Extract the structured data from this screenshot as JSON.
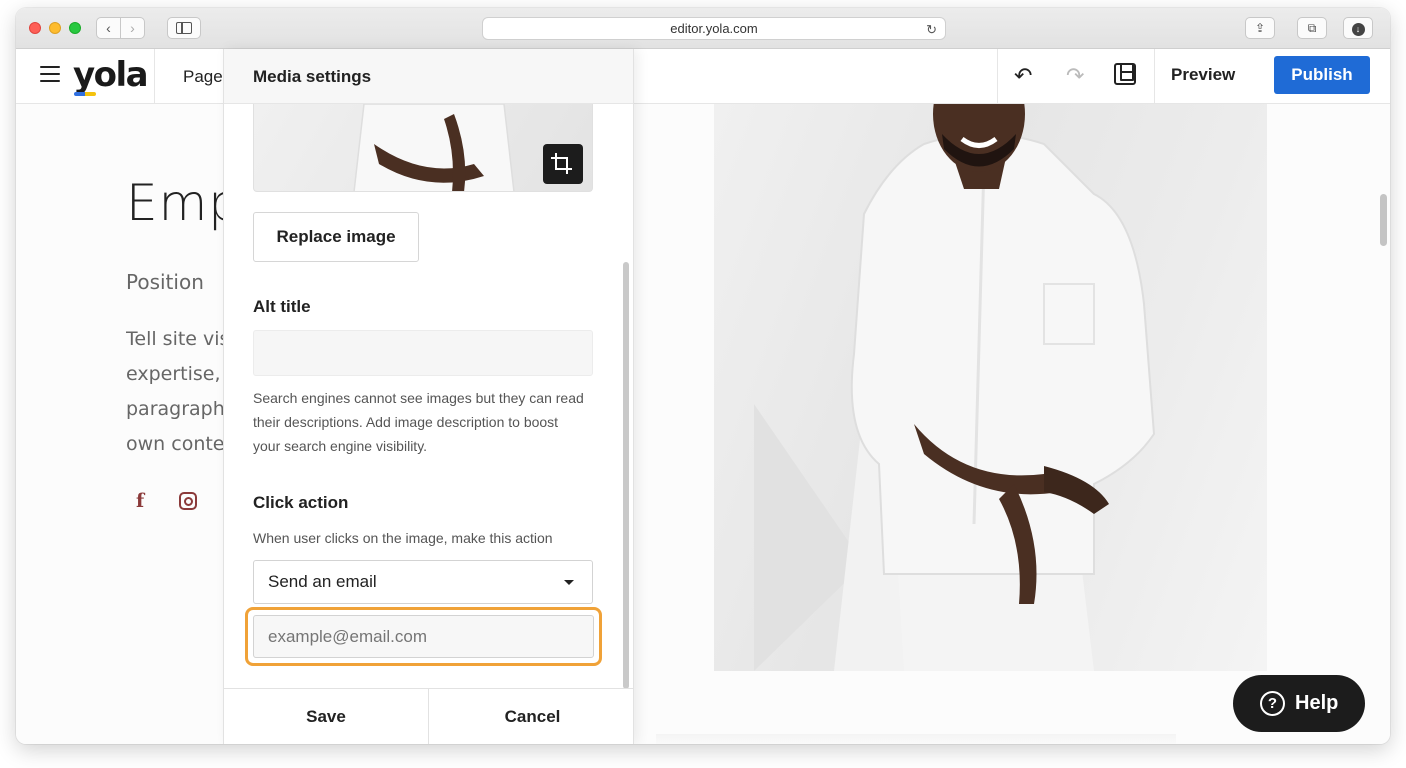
{
  "browser": {
    "url": "editor.yola.com",
    "back_glyph": "‹",
    "forward_glyph": "›",
    "reload_glyph": "↻",
    "share_glyph": "⇪",
    "tabs_glyph": "⧉",
    "download_glyph": "↓"
  },
  "toolbar": {
    "logo": "yola",
    "pages_label": "Page",
    "undo_glyph": "↶",
    "redo_glyph": "↷",
    "preview_label": "Preview",
    "publish_label": "Publish",
    "publish_color": "#1f6bd6"
  },
  "page": {
    "heading": "Emp",
    "position": "Position",
    "bio_lines": [
      "Tell site vis",
      "expertise,",
      "paragraph",
      "own conte"
    ],
    "social": {
      "facebook": "f"
    }
  },
  "panel": {
    "title": "Media settings",
    "replace_label": "Replace image",
    "alt_label": "Alt title",
    "alt_value": "",
    "alt_help": "Search engines cannot see images but they can read their descriptions. Add image description to boost your search engine visibility.",
    "click_label": "Click action",
    "click_help": "When user clicks on the image, make this action",
    "click_action_selected": "Send an email",
    "email_placeholder": "example@email.com",
    "save_label": "Save",
    "cancel_label": "Cancel",
    "highlight_color": "#f0a238"
  },
  "help": {
    "label": "Help",
    "icon_glyph": "?"
  }
}
